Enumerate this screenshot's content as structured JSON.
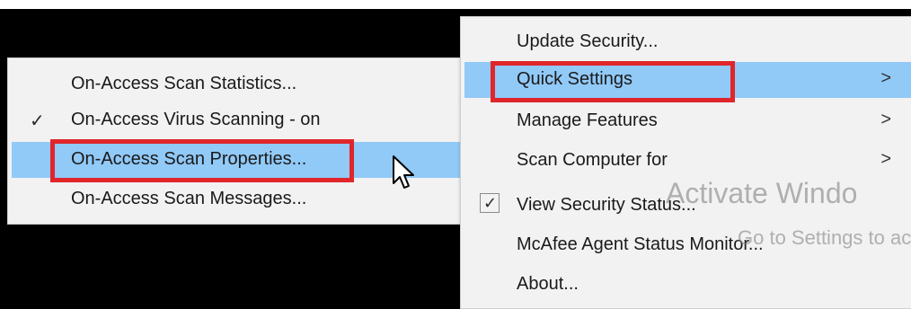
{
  "submenu": {
    "items": [
      {
        "label": "On-Access Scan Statistics...",
        "checked": false,
        "highlighted": false
      },
      {
        "label": "On-Access Virus Scanning - on",
        "checked": true,
        "highlighted": false
      },
      {
        "label": "On-Access Scan Properties...",
        "checked": false,
        "highlighted": true
      },
      {
        "label": "On-Access Scan Messages...",
        "checked": false,
        "highlighted": false
      }
    ],
    "check_glyph": "✓"
  },
  "main_menu": {
    "items": [
      {
        "label": "Update Security...",
        "has_submenu": false,
        "highlighted": false
      },
      {
        "label": "Quick Settings",
        "has_submenu": true,
        "highlighted": true
      },
      {
        "label": "Manage Features",
        "has_submenu": true,
        "highlighted": false
      },
      {
        "label": "Scan Computer for",
        "has_submenu": true,
        "highlighted": false
      },
      {
        "label": "View Security Status...",
        "has_submenu": false,
        "highlighted": false,
        "checked": true
      },
      {
        "label": "McAfee Agent Status Monitor...",
        "has_submenu": false,
        "highlighted": false
      },
      {
        "label": "About...",
        "has_submenu": false,
        "highlighted": false
      }
    ],
    "chevron_glyph": ">",
    "check_glyph": "✓"
  },
  "watermark": {
    "line1": "Activate Windo",
    "line2": "Go to Settings to act"
  },
  "colors": {
    "menu_background": "#f2f2f2",
    "highlight": "#91c9f7",
    "annotation_red": "#e0262b",
    "backdrop": "#000000"
  }
}
